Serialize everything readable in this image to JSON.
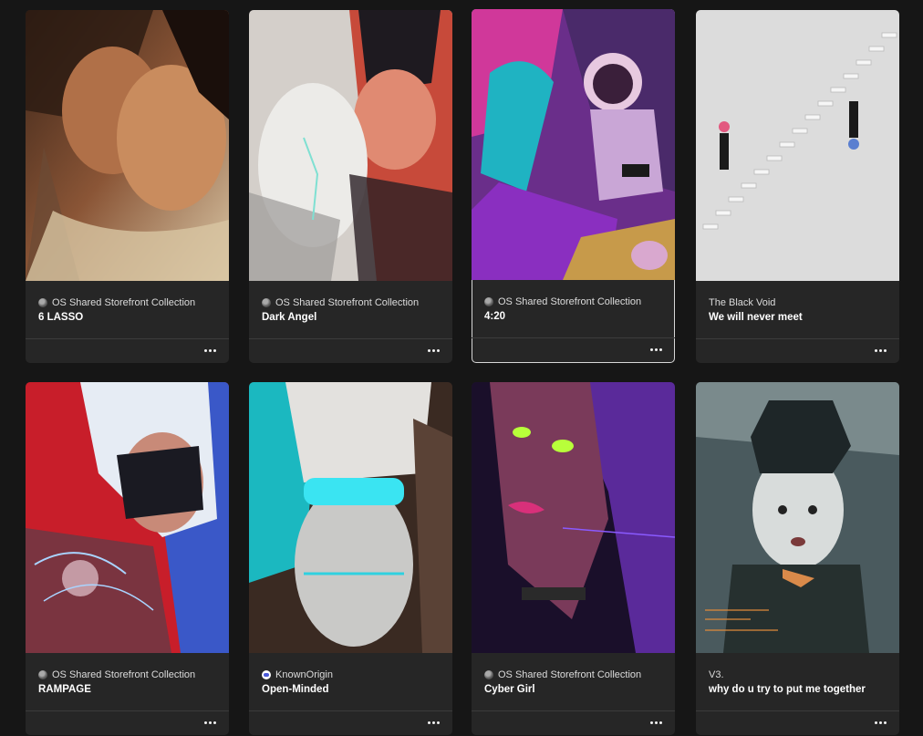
{
  "cards": [
    {
      "collection": "OS Shared Storefront Collection",
      "collection_icon": "opensea-storefront-icon",
      "title": "6 LASSO",
      "artwork": "kissing-couple-painting"
    },
    {
      "collection": "OS Shared Storefront Collection",
      "collection_icon": "opensea-storefront-icon",
      "title": "Dark Angel",
      "artwork": "embracing-couple-painting"
    },
    {
      "collection": "OS Shared Storefront Collection",
      "collection_icon": "opensea-storefront-icon",
      "title": "4:20",
      "artwork": "astronaut-and-woman-painting",
      "active": true
    },
    {
      "collection": "The Black Void",
      "collection_icon": "",
      "title": "We will never meet",
      "artwork": "staircase-figures-illustration"
    },
    {
      "collection": "OS Shared Storefront Collection",
      "collection_icon": "opensea-storefront-icon",
      "title": "RAMPAGE",
      "artwork": "cyber-masked-woman-art"
    },
    {
      "collection": "KnownOrigin",
      "collection_icon": "knownorigin-icon",
      "title": "Open-Minded",
      "artwork": "glowing-visor-figure-art"
    },
    {
      "collection": "OS Shared Storefront Collection",
      "collection_icon": "opensea-storefront-icon",
      "title": "Cyber Girl",
      "artwork": "neon-eyed-android-portrait"
    },
    {
      "collection": "V3.",
      "collection_icon": "",
      "title": "why do u try to put me together",
      "artwork": "fractured-face-glitch-art"
    }
  ],
  "more_icon": "ellipsis-icon",
  "colors": {
    "background": "#161616",
    "card": "#262626",
    "active_outline": "#d6d6d6"
  }
}
